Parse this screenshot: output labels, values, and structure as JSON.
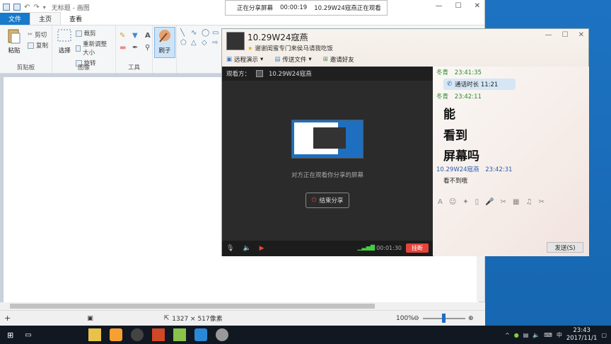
{
  "paint": {
    "title": "无标题 - 画图",
    "tabs": {
      "file": "文件",
      "home": "主页",
      "view": "查看"
    },
    "groups": {
      "clipboard": {
        "label": "剪贴板",
        "paste": "粘贴",
        "cut": "剪切",
        "copy": "复制"
      },
      "image": {
        "label": "图像",
        "select": "选择",
        "crop": "裁剪",
        "resize": "重新调整大小",
        "rotate": "旋转"
      },
      "tools": {
        "label": "工具"
      },
      "brush": {
        "label": "刷子"
      }
    },
    "status": {
      "size": "1327 × 517像素",
      "zoom": "100%"
    }
  },
  "share_bar": {
    "label": "正在分享屏幕",
    "time": "00:00:19",
    "message": "10.29W24寇燕正在观看"
  },
  "qq": {
    "name": "10.29W24寇燕",
    "signature": "谢谢闺蜜专门来侯马请我吃饭",
    "toolbar": {
      "remote": "远程演示",
      "send_file": "传送文件",
      "invite": "邀请好友"
    },
    "video": {
      "viewers_label": "观看方：",
      "viewer": "10.29W24寇燕",
      "share_msg": "对方正在观看你分享的屏幕",
      "end_share": "结束分享",
      "timer": "00:01:30",
      "hangup": "挂断"
    },
    "chat": {
      "sender1": "冬青",
      "time1": "23:41:35",
      "call_duration": "通话时长 11:21",
      "time2": "23:42:11",
      "line1": "能",
      "line2": "看到",
      "line3": "屏幕吗",
      "sender2": "10.29W24寇燕",
      "time3": "23:42:31",
      "reply": "看不到哦",
      "send": "发送(S)"
    }
  },
  "taskbar": {
    "ime": "中",
    "time": "23:43",
    "date": "2017/11/1"
  }
}
